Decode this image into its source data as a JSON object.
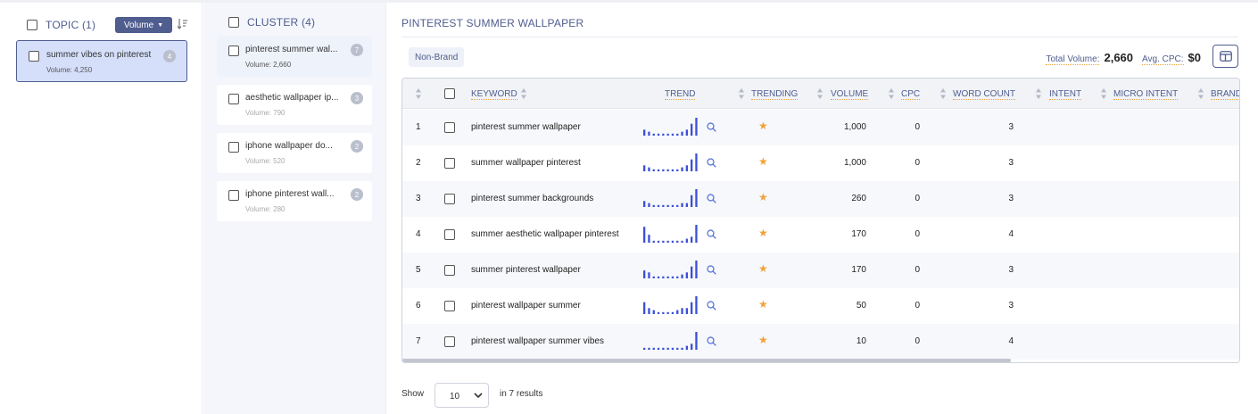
{
  "topic": {
    "label": "TOPIC (1)",
    "sort_label": "Volume"
  },
  "topics": [
    {
      "title": "summer vibes on pinterest",
      "volume": "Volume: 4,250",
      "count": "4"
    }
  ],
  "cluster": {
    "label": "CLUSTER (4)"
  },
  "clusters": [
    {
      "title": "pinterest summer wal...",
      "volume": "Volume: 2,660",
      "count": "7"
    },
    {
      "title": "aesthetic wallpaper ip...",
      "volume": "Volume: 790",
      "count": "3"
    },
    {
      "title": "iphone wallpaper do...",
      "volume": "Volume: 520",
      "count": "2"
    },
    {
      "title": "iphone pinterest wall...",
      "volume": "Volume: 280",
      "count": "2"
    }
  ],
  "main": {
    "title": "PINTEREST SUMMER WALLPAPER",
    "chip": "Non-Brand",
    "total_volume_label": "Total Volume:",
    "total_volume": "2,660",
    "avg_cpc_label": "Avg. CPC:",
    "avg_cpc": "$0"
  },
  "table": {
    "headers": {
      "keyword": "KEYWORD",
      "trend": "TREND",
      "trending": "TRENDING",
      "volume": "VOLUME",
      "cpc": "CPC",
      "word_count": "WORD COUNT",
      "intent": "INTENT",
      "micro_intent": "MICRO INTENT",
      "brand": "BRAND"
    },
    "rows": [
      {
        "n": "1",
        "keyword": "pinterest summer wallpaper",
        "volume": "1,000",
        "cpc": "0",
        "wc": "3",
        "trend": [
          3,
          2,
          1,
          1,
          1,
          1,
          1,
          1,
          2,
          3,
          6,
          9
        ]
      },
      {
        "n": "2",
        "keyword": "summer wallpaper pinterest",
        "volume": "1,000",
        "cpc": "0",
        "wc": "3",
        "trend": [
          3,
          2,
          1,
          1,
          1,
          1,
          1,
          1,
          2,
          3,
          6,
          9
        ]
      },
      {
        "n": "3",
        "keyword": "pinterest summer backgrounds",
        "volume": "260",
        "cpc": "0",
        "wc": "3",
        "trend": [
          3,
          2,
          1,
          1,
          1,
          1,
          1,
          1,
          2,
          2,
          6,
          9
        ]
      },
      {
        "n": "4",
        "keyword": "summer aesthetic wallpaper pinterest",
        "volume": "170",
        "cpc": "0",
        "wc": "4",
        "trend": [
          8,
          4,
          1,
          1,
          1,
          1,
          1,
          1,
          1,
          2,
          3,
          9
        ]
      },
      {
        "n": "5",
        "keyword": "summer pinterest wallpaper",
        "volume": "170",
        "cpc": "0",
        "wc": "3",
        "trend": [
          4,
          3,
          1,
          1,
          1,
          1,
          1,
          1,
          2,
          3,
          6,
          9
        ]
      },
      {
        "n": "6",
        "keyword": "pinterest wallpaper summer",
        "volume": "50",
        "cpc": "0",
        "wc": "3",
        "trend": [
          6,
          3,
          2,
          1,
          1,
          1,
          1,
          2,
          3,
          3,
          6,
          9
        ]
      },
      {
        "n": "7",
        "keyword": "pinterest wallpaper summer vibes",
        "volume": "10",
        "cpc": "0",
        "wc": "4",
        "trend": [
          1,
          1,
          1,
          1,
          1,
          1,
          1,
          1,
          1,
          2,
          3,
          9
        ]
      }
    ]
  },
  "pagination": {
    "show_label": "Show",
    "page_size": "10",
    "results": "in 7 results"
  },
  "colors": {
    "accent": "#4f5d8f",
    "star": "#f0a33a",
    "bar": "#3b4fd8",
    "selected_bg": "#d5dffa"
  }
}
